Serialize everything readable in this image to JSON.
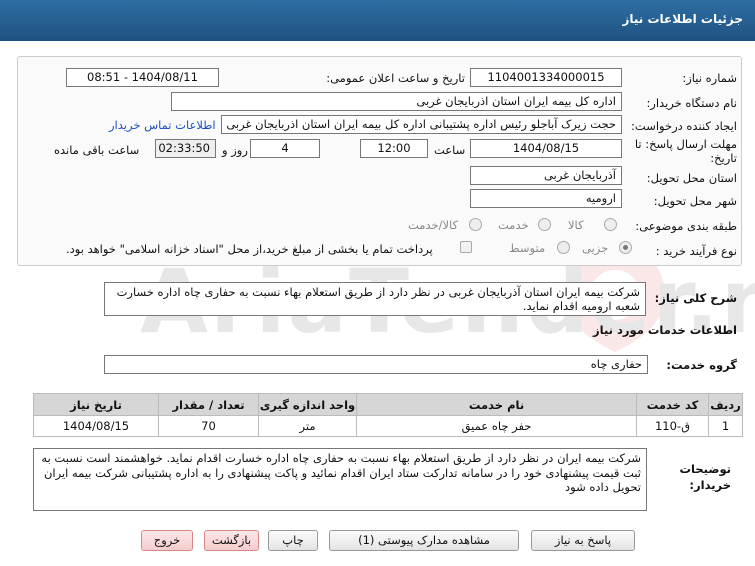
{
  "header": {
    "title": "جزئیات اطلاعات نیاز"
  },
  "watermark": {
    "text": "AriaTender.net"
  },
  "form": {
    "need_number": {
      "label": "شماره نیاز:",
      "value": "1104001334000015"
    },
    "announce_datetime": {
      "label": "تاریخ و ساعت اعلان عمومی:",
      "value": "1404/08/11 - 08:51"
    },
    "buyer_org": {
      "label": "نام دستگاه خریدار:",
      "value": "اداره کل بیمه ایران استان اذربایجان غربی"
    },
    "requester": {
      "label": "ایجاد کننده درخواست:",
      "value": "حجت زیرک آباجلو رئیس اداره پشتیبانی اداره کل بیمه ایران استان اذربایجان غربی",
      "contact_link": "اطلاعات تماس خریدار"
    },
    "deadline": {
      "label_line1": "مهلت ارسال پاسخ: تا",
      "label_line2": "تاریخ:",
      "date": "1404/08/15",
      "time_label": "ساعت",
      "time": "12:00",
      "days": "4",
      "days_label": "روز و",
      "remaining": "02:33:50",
      "remaining_label": "ساعت باقی مانده"
    },
    "province": {
      "label": "استان محل تحویل:",
      "value": "آذربایجان غربی"
    },
    "city": {
      "label": "شهر محل تحویل:",
      "value": "ارومیه"
    },
    "category": {
      "label": "طبقه بندی موضوعی:",
      "options": [
        "کالا",
        "خدمت",
        "کالا/خدمت"
      ],
      "selected": ""
    },
    "process_type": {
      "label": "نوع فرآیند خرید :",
      "options": [
        "جزیی",
        "متوسط"
      ],
      "selected": "جزیی",
      "payment_note": "پرداخت تمام یا بخشی از مبلغ خرید،از محل \"اسناد خزانه اسلامی\" خواهد بود."
    }
  },
  "description": {
    "label": "شرح کلی نیاز:",
    "value": "شرکت بیمه ایران استان آذربایجان غربی در نظر دارد از طریق استعلام بهاء نسبت به حفاری چاه اداره خسارت شعبه ارومیه اقدام نماید."
  },
  "services": {
    "section_title": "اطلاعات خدمات مورد نیاز",
    "group_label": "گروه خدمت:",
    "group_value": "حفاری چاه",
    "columns": [
      "ردیف",
      "کد خدمت",
      "نام خدمت",
      "واحد اندازه گیری",
      "تعداد / مقدار",
      "تاریخ نیاز"
    ],
    "rows": [
      [
        "1",
        "ق-110",
        "حفر چاه عمیق",
        "متر",
        "70",
        "1404/08/15"
      ]
    ]
  },
  "buyer_notes": {
    "label_line1": "توضیحات",
    "label_line2": "خریدار:",
    "value": "شرکت بیمه ایران در نظر دارد از طریق استعلام بهاء نسبت به حفاری چاه اداره خسارت اقدام نماید. خواهشمند است نسبت به ثبت  قیمت پیشنهادی خود را در سامانه تدارکت ستاد ایران  اقدام نمائید و پاکت پیشنهادی را به اداره پشتیبانی شرکت بیمه ایران تحویل داده شود"
  },
  "buttons": {
    "reply": "پاسخ به نیاز",
    "attachments": "مشاهده مدارک پیوستی (1)",
    "print": "چاپ",
    "back": "بازگشت",
    "exit": "خروج"
  }
}
